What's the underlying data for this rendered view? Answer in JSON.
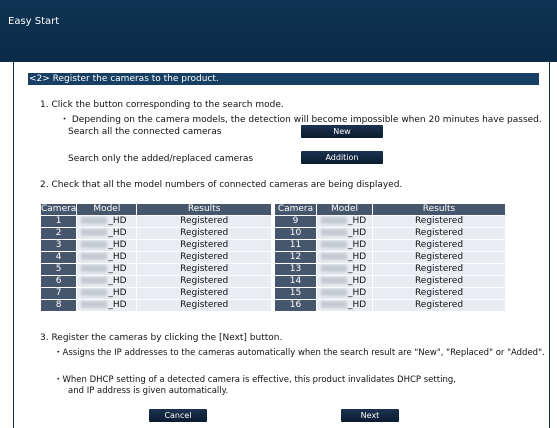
{
  "window": {
    "title": "Easy Start"
  },
  "section": {
    "title": "<2> Register the cameras to the product."
  },
  "step1": {
    "heading": "1. Click the button corresponding to the search mode.",
    "note": "・ Depending on the camera models, the detection will become impossible when 20 minutes have passed.",
    "search_all_label": "Search all the connected cameras",
    "new_button": "New",
    "search_added_label": "Search only the  added/replaced cameras",
    "addition_button": "Addition"
  },
  "step2": {
    "heading": "2. Check that all the model numbers of connected cameras are being displayed."
  },
  "table": {
    "headers": {
      "camera": "Camera",
      "model": "Model",
      "results": "Results"
    },
    "left_rows": [
      {
        "camera": "1",
        "model": "_HD",
        "result": "Registered"
      },
      {
        "camera": "2",
        "model": "_HD",
        "result": "Registered"
      },
      {
        "camera": "3",
        "model": "_HD",
        "result": "Registered"
      },
      {
        "camera": "4",
        "model": "_HD",
        "result": "Registered"
      },
      {
        "camera": "5",
        "model": "_HD",
        "result": "Registered"
      },
      {
        "camera": "6",
        "model": "_HD",
        "result": "Registered"
      },
      {
        "camera": "7",
        "model": "_HD",
        "result": "Registered"
      },
      {
        "camera": "8",
        "model": "_HD",
        "result": "Registered"
      }
    ],
    "right_rows": [
      {
        "camera": "9",
        "model": "_HD",
        "result": "Registered"
      },
      {
        "camera": "10",
        "model": "_HD",
        "result": "Registered"
      },
      {
        "camera": "11",
        "model": "_HD",
        "result": "Registered"
      },
      {
        "camera": "12",
        "model": "_HD",
        "result": "Registered"
      },
      {
        "camera": "13",
        "model": "_HD",
        "result": "Registered"
      },
      {
        "camera": "14",
        "model": "_HD",
        "result": "Registered"
      },
      {
        "camera": "15",
        "model": "_HD",
        "result": "Registered"
      },
      {
        "camera": "16",
        "model": "_HD",
        "result": "Registered"
      }
    ]
  },
  "step3": {
    "heading": "3. Register the cameras by clicking the [Next] button.",
    "note1": "・Assigns the IP addresses to the cameras automatically when the search result are \"New\", \"Replaced\" or \"Added\".",
    "note2a": "・When DHCP setting of a detected camera is effective, this product invalidates DHCP setting,",
    "note2b": "and IP address is given automatically."
  },
  "footer": {
    "cancel_button": "Cancel",
    "next_button": "Next"
  },
  "colors": {
    "titlebar": "#0f3353",
    "section_bar": "#173f63",
    "table_header": "#46566c",
    "button": "#0a1b30"
  }
}
